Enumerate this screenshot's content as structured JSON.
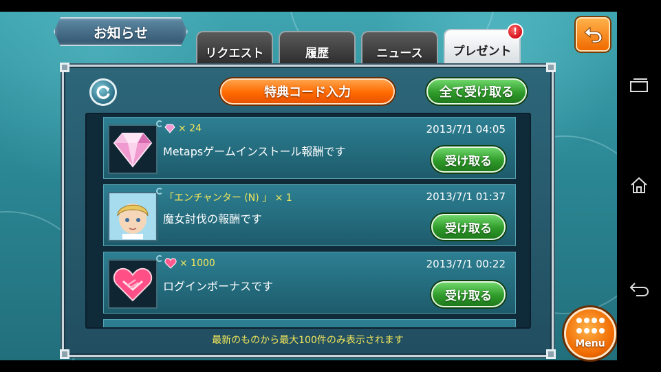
{
  "title": "お知らせ",
  "tabs": [
    {
      "label": "リクエスト",
      "active": false
    },
    {
      "label": "履歴",
      "active": false
    },
    {
      "label": "ニュース",
      "active": false
    },
    {
      "label": "プレゼント",
      "active": true,
      "badge": "!"
    }
  ],
  "toolbar": {
    "code_button": "特典コード入力",
    "claim_all": "全て受け取る"
  },
  "gifts": [
    {
      "reward_icon": "pink-gem-icon",
      "reward": "× 24",
      "timestamp": "2013/7/1 04:05",
      "message": "Metapsゲームインストール報酬です",
      "thumb": "diamond-icon",
      "button": "受け取る"
    },
    {
      "reward_icon": "",
      "reward": "「エンチャンター (N) 」 × 1",
      "timestamp": "2013/7/1 01:37",
      "message": "魔女討伐の報酬です",
      "thumb": "character-portrait",
      "button": "受け取る"
    },
    {
      "reward_icon": "heart-gem-icon",
      "reward": "× 1000",
      "timestamp": "2013/7/1 00:22",
      "message": "ログインボーナスです",
      "thumb": "handshake-heart-icon",
      "button": "受け取る"
    }
  ],
  "footer_note": "最新のものから最大100件のみ表示されます",
  "menu_label": "Menu",
  "colors": {
    "accent_orange": "#f06a00",
    "accent_green": "#2f9b2a",
    "highlight_yellow": "#f4e85a",
    "panel": "#2d6679"
  }
}
